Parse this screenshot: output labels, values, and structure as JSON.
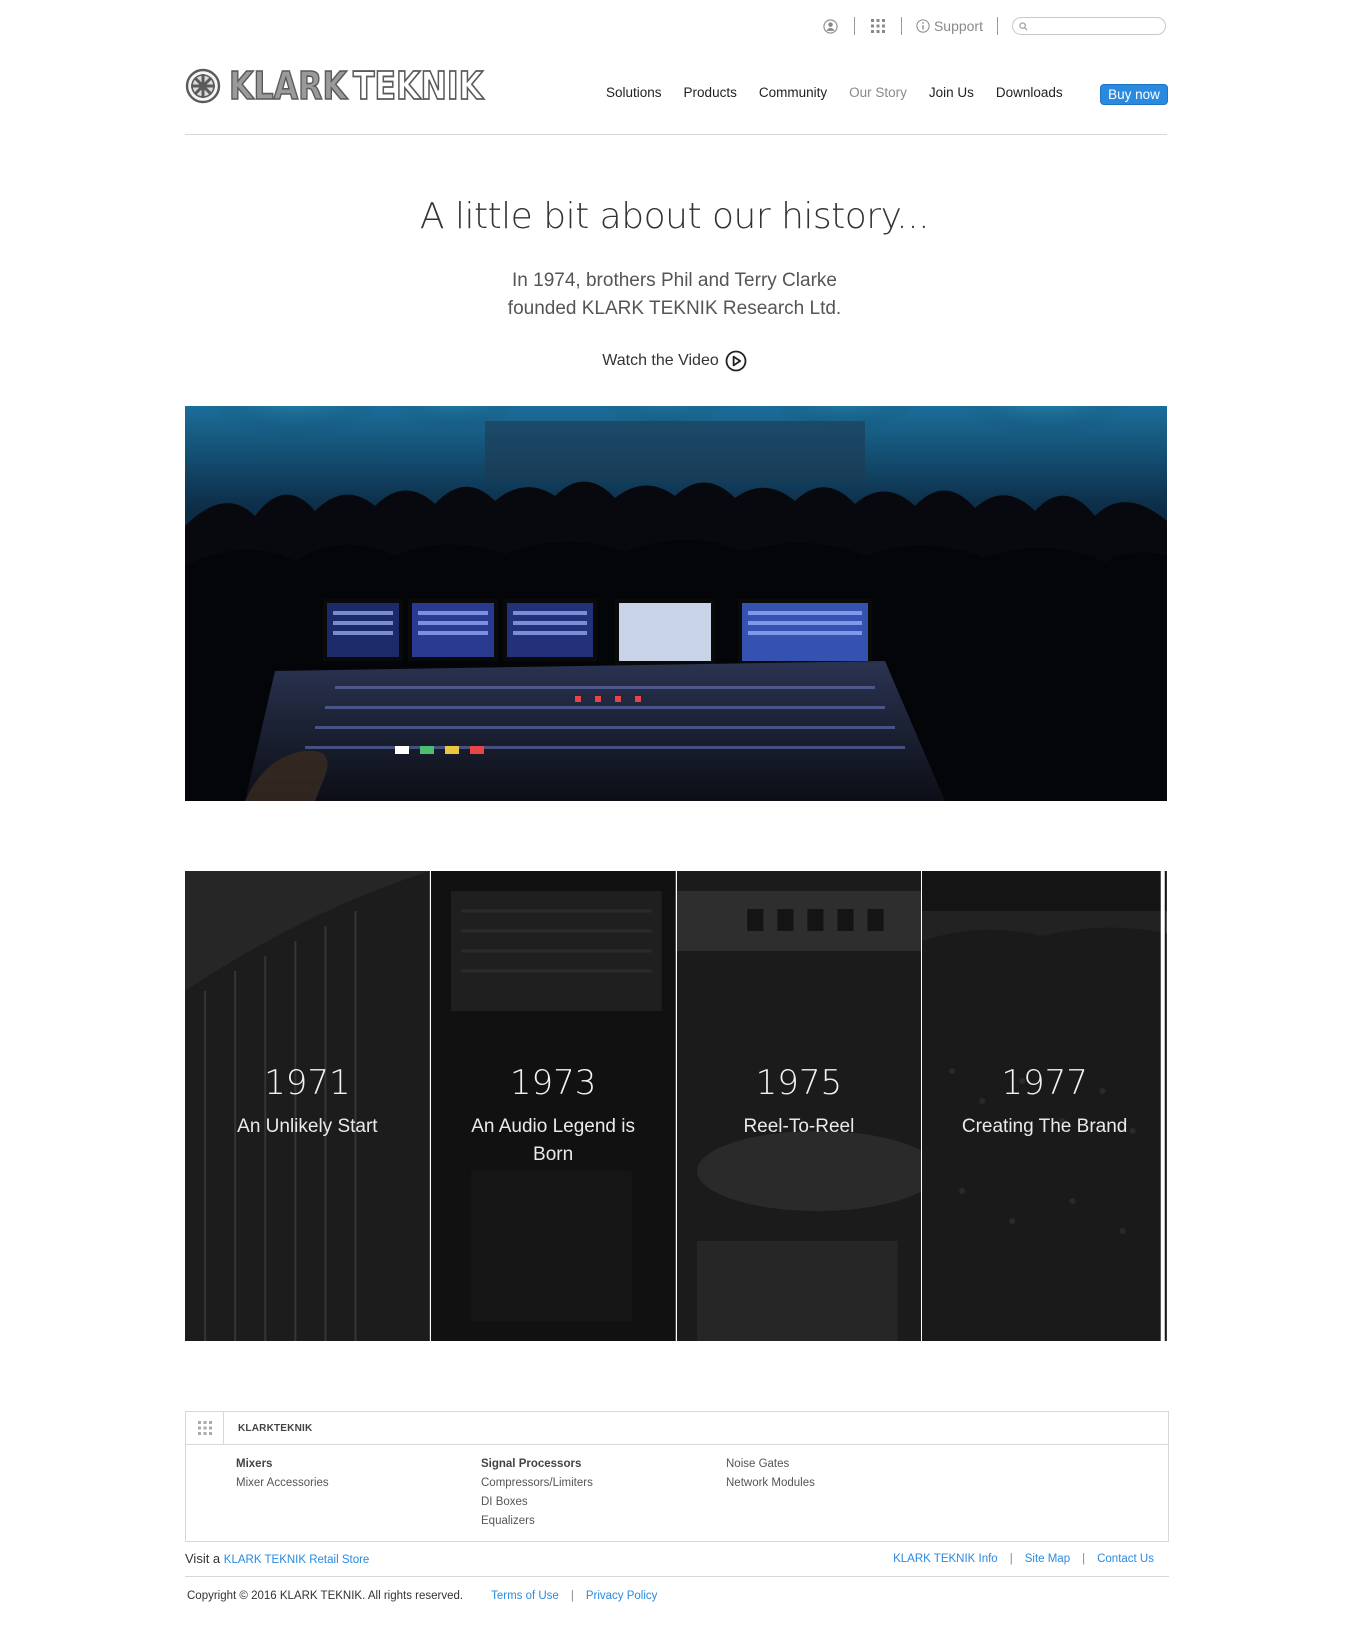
{
  "utility": {
    "support_label": "Support",
    "search_placeholder": ""
  },
  "brand": {
    "logo_text_bold": "KLARK",
    "logo_text_outline": "TEKNIK"
  },
  "nav": {
    "items": [
      {
        "label": "Solutions"
      },
      {
        "label": "Products"
      },
      {
        "label": "Community"
      },
      {
        "label": "Our Story"
      },
      {
        "label": "Join Us"
      },
      {
        "label": "Downloads"
      }
    ],
    "active": "Our Story",
    "buy_label": "Buy now"
  },
  "intro": {
    "title": "A little bit about our history...",
    "sub_line1": "In 1974, brothers Phil and Terry Clarke",
    "sub_line2": "founded KLARK TEKNIK Research Ltd.",
    "watch_label": "Watch the Video"
  },
  "timeline": [
    {
      "year": "1971",
      "caption": "An Unlikely Start"
    },
    {
      "year": "1973",
      "caption": "An Audio Legend is Born"
    },
    {
      "year": "1975",
      "caption": "Reel-To-Reel"
    },
    {
      "year": "1977",
      "caption": "Creating The Brand"
    }
  ],
  "footer": {
    "brand": "KLARKTEKNIK",
    "col1": {
      "heading": "Mixers",
      "links": [
        "Mixer Accessories"
      ]
    },
    "col2": {
      "heading": "Signal Processors",
      "links": [
        "Compressors/Limiters",
        "DI Boxes",
        "Equalizers"
      ]
    },
    "col3": {
      "links": [
        "Noise Gates",
        "Network Modules"
      ]
    },
    "visit_prefix": "Visit a",
    "visit_link": "KLARK TEKNIK Retail Store",
    "links": [
      "KLARK TEKNIK Info",
      "Site Map",
      "Contact Us"
    ],
    "copyright": "Copyright © 2016 KLARK TEKNIK. All rights reserved.",
    "legal": [
      "Terms of Use",
      "Privacy Policy"
    ]
  },
  "colors": {
    "accent": "#2a8ae0",
    "text": "#333333"
  }
}
